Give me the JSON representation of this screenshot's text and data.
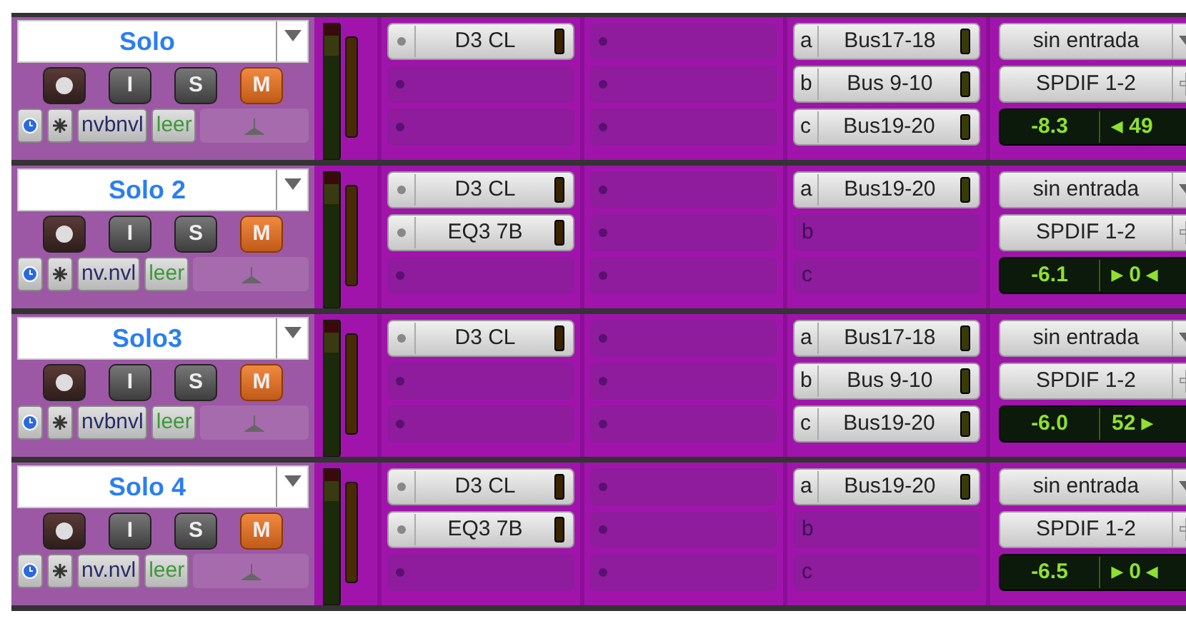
{
  "tracks": [
    {
      "name": "Solo",
      "record_armed": false,
      "input_monitor": false,
      "input_label": "I",
      "soloed": false,
      "solo_label": "S",
      "muted": true,
      "mute_label": "M",
      "voice": "nvbnvl",
      "automation": "leer",
      "inserts_a": [
        {
          "kind": "plugin",
          "name": "D3 CL"
        },
        {
          "kind": "empty"
        },
        {
          "kind": "empty"
        }
      ],
      "inserts_b": [
        {
          "kind": "empty"
        },
        {
          "kind": "empty"
        },
        {
          "kind": "empty"
        }
      ],
      "sends": [
        {
          "kind": "send",
          "letter": "a",
          "name": "Bus17-18"
        },
        {
          "kind": "send",
          "letter": "b",
          "name": "Bus 9-10"
        },
        {
          "kind": "send",
          "letter": "c",
          "name": "Bus19-20"
        }
      ],
      "input": "sin entrada",
      "output": "SPDIF 1-2",
      "volume": "-8.3",
      "pan": "◂ 49"
    },
    {
      "name": "Solo 2",
      "record_armed": false,
      "input_monitor": false,
      "input_label": "I",
      "soloed": false,
      "solo_label": "S",
      "muted": true,
      "mute_label": "M",
      "voice": "nv.nvl",
      "automation": "leer",
      "inserts_a": [
        {
          "kind": "plugin",
          "name": "D3 CL"
        },
        {
          "kind": "plugin",
          "name": "EQ3 7B"
        },
        {
          "kind": "empty"
        }
      ],
      "inserts_b": [
        {
          "kind": "empty"
        },
        {
          "kind": "empty"
        },
        {
          "kind": "empty"
        }
      ],
      "sends": [
        {
          "kind": "send",
          "letter": "a",
          "name": "Bus19-20"
        },
        {
          "kind": "empty",
          "letter": "b"
        },
        {
          "kind": "empty",
          "letter": "c"
        }
      ],
      "input": "sin entrada",
      "output": "SPDIF 1-2",
      "volume": "-6.1",
      "pan": "▸ 0 ◂"
    },
    {
      "name": "Solo3",
      "record_armed": false,
      "input_monitor": false,
      "input_label": "I",
      "soloed": false,
      "solo_label": "S",
      "muted": true,
      "mute_label": "M",
      "voice": "nvbnvl",
      "automation": "leer",
      "inserts_a": [
        {
          "kind": "plugin",
          "name": "D3 CL"
        },
        {
          "kind": "empty"
        },
        {
          "kind": "empty"
        }
      ],
      "inserts_b": [
        {
          "kind": "empty"
        },
        {
          "kind": "empty"
        },
        {
          "kind": "empty"
        }
      ],
      "sends": [
        {
          "kind": "send",
          "letter": "a",
          "name": "Bus17-18"
        },
        {
          "kind": "send",
          "letter": "b",
          "name": "Bus 9-10"
        },
        {
          "kind": "send",
          "letter": "c",
          "name": "Bus19-20"
        }
      ],
      "input": "sin entrada",
      "output": "SPDIF 1-2",
      "volume": "-6.0",
      "pan": "52 ▸"
    },
    {
      "name": "Solo 4",
      "record_armed": false,
      "input_monitor": false,
      "input_label": "I",
      "soloed": false,
      "solo_label": "S",
      "muted": true,
      "mute_label": "M",
      "voice": "nv.nvl",
      "automation": "leer",
      "inserts_a": [
        {
          "kind": "plugin",
          "name": "D3 CL"
        },
        {
          "kind": "plugin",
          "name": "EQ3 7B"
        },
        {
          "kind": "empty"
        }
      ],
      "inserts_b": [
        {
          "kind": "empty"
        },
        {
          "kind": "empty"
        },
        {
          "kind": "empty"
        }
      ],
      "sends": [
        {
          "kind": "send",
          "letter": "a",
          "name": "Bus19-20"
        },
        {
          "kind": "empty",
          "letter": "b"
        },
        {
          "kind": "empty",
          "letter": "c"
        }
      ],
      "input": "sin entrada",
      "output": "SPDIF 1-2",
      "volume": "-6.5",
      "pan": "▸ 0 ◂"
    }
  ]
}
